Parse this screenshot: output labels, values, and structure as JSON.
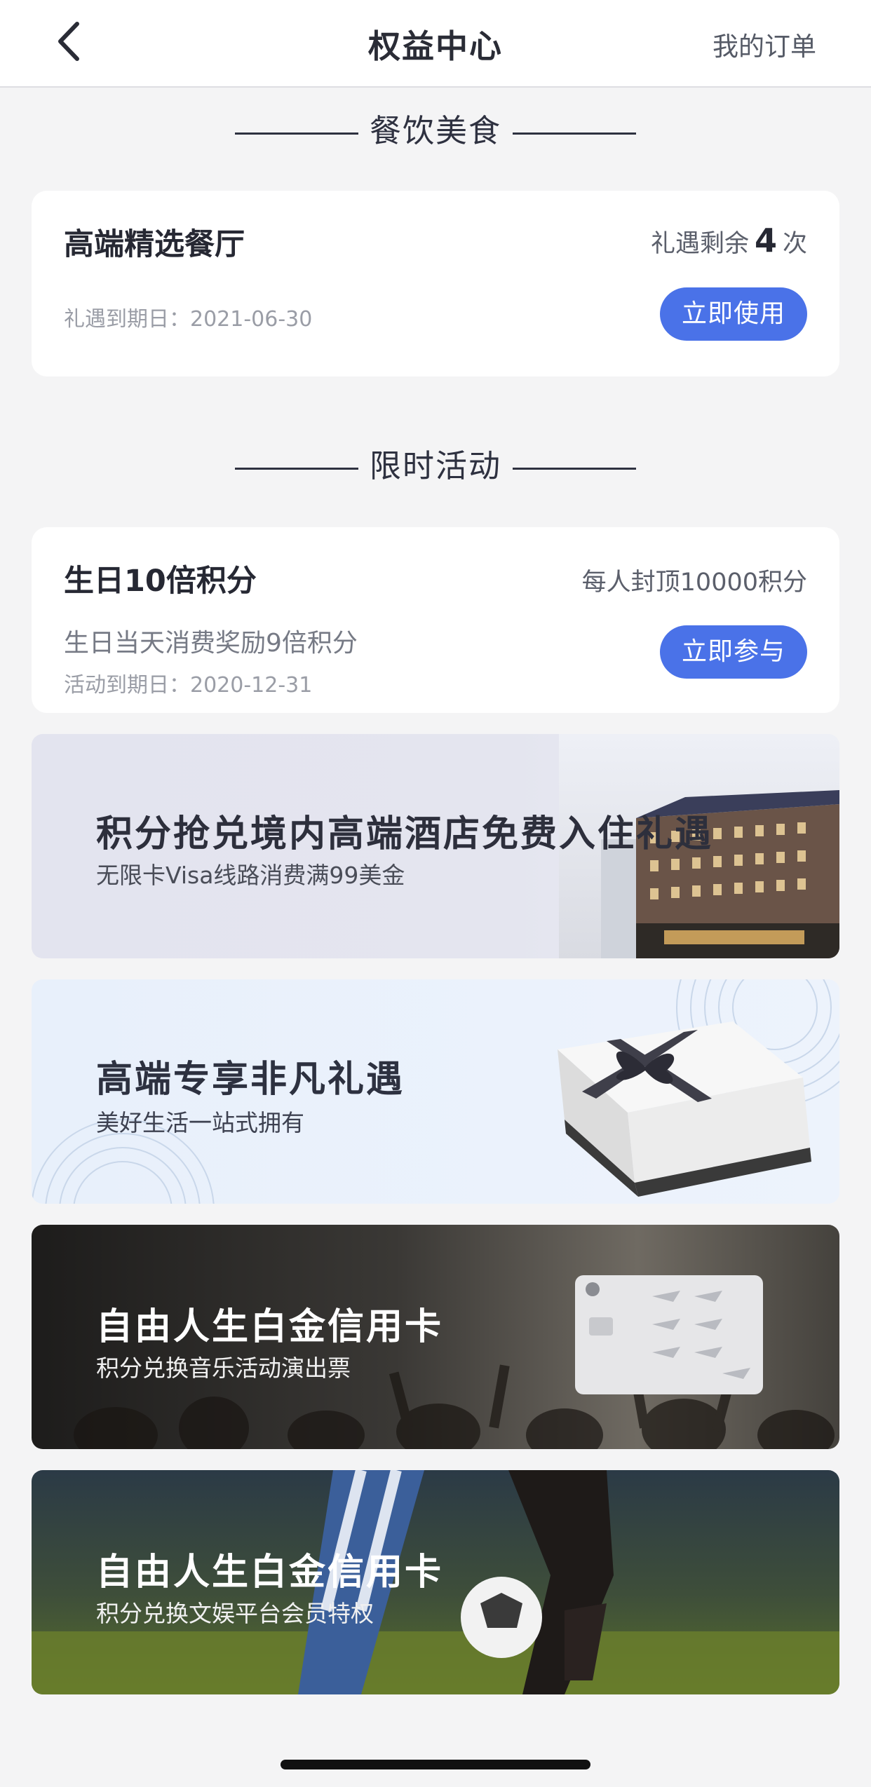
{
  "header": {
    "title": "权益中心",
    "orders_label": "我的订单"
  },
  "sections": {
    "dining": "餐饮美食",
    "limited": "限时活动"
  },
  "dining_card": {
    "title": "高端精选餐厅",
    "remaining_prefix": "礼遇剩余",
    "remaining_count": "4",
    "remaining_suffix": "次",
    "expiry": "礼遇到期日：2021-06-30",
    "button": "立即使用"
  },
  "birthday_card": {
    "title": "生日10倍积分",
    "cap": "每人封顶10000积分",
    "desc": "生日当天消费奖励9倍积分",
    "expiry": "活动到期日：2020-12-31",
    "button": "立即参与"
  },
  "banners": [
    {
      "title": "积分抢兑境内高端酒店免费入住礼遇",
      "subtitle": "无限卡Visa线路消费满99美金"
    },
    {
      "title": "高端专享非凡礼遇",
      "subtitle": "美好生活一站式拥有"
    },
    {
      "title": "自由人生白金信用卡",
      "subtitle": "积分兑换音乐活动演出票"
    },
    {
      "title": "自由人生白金信用卡",
      "subtitle": "积分兑换文娱平台会员特权"
    }
  ],
  "colors": {
    "accent": "#4a72e8",
    "background": "#f4f4f5"
  }
}
